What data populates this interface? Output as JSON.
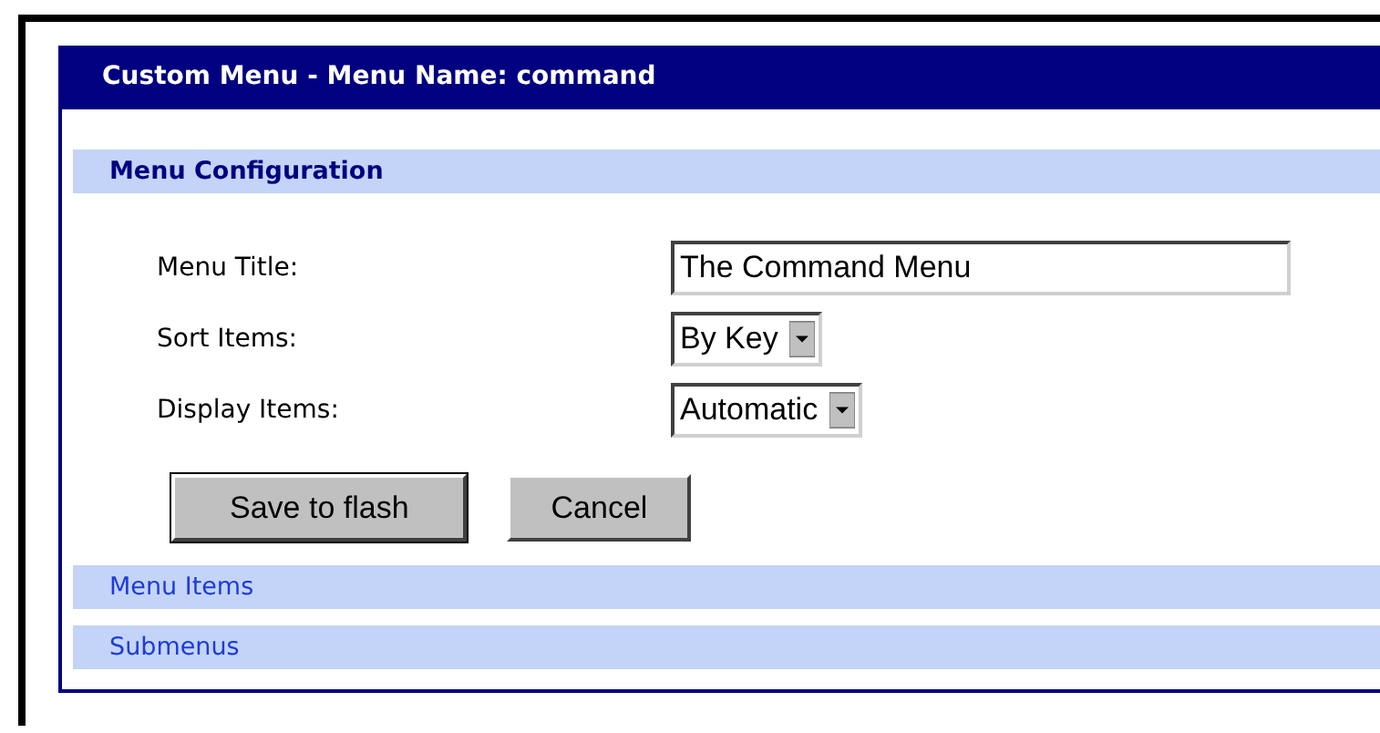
{
  "panel": {
    "title": "Custom Menu - Menu Name: command"
  },
  "sections": [
    {
      "title": "Menu Configuration",
      "expanded": true,
      "fields": [
        {
          "label": "Menu Title:",
          "kind": "text",
          "value": "The Command Menu"
        },
        {
          "label": "Sort Items:",
          "kind": "select",
          "value": "By Key"
        },
        {
          "label": "Display Items:",
          "kind": "select",
          "value": "Automatic"
        }
      ],
      "buttons": [
        {
          "label": "Save to flash",
          "default": true
        },
        {
          "label": "Cancel",
          "default": false
        }
      ]
    },
    {
      "title": "Menu Items",
      "expanded": false
    },
    {
      "title": "Submenus",
      "expanded": false
    }
  ]
}
